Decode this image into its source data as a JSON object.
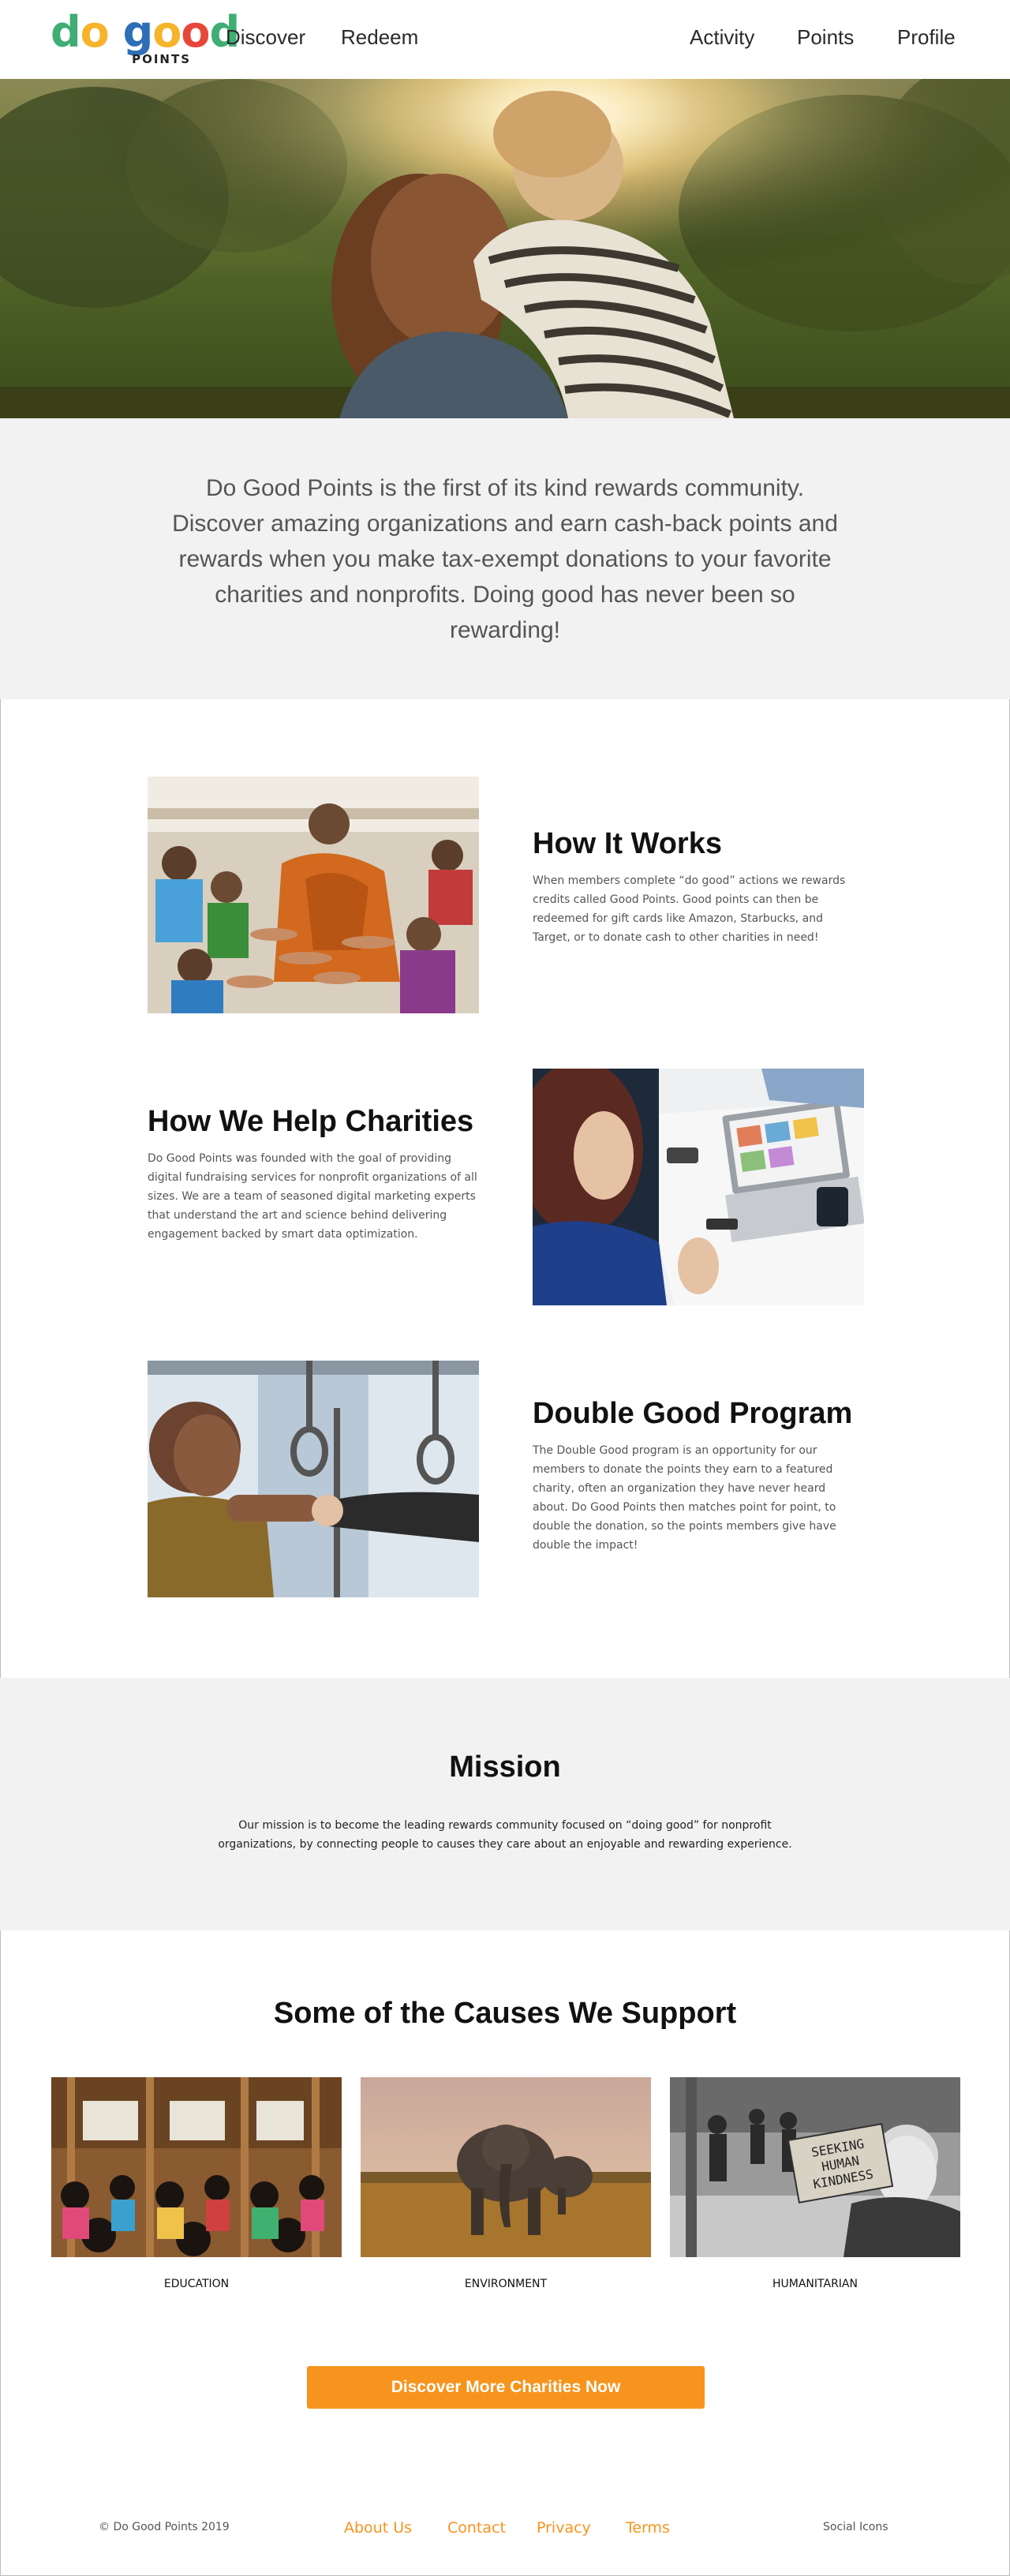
{
  "header": {
    "logo": {
      "word_do": "do",
      "word_good": "good",
      "sub": "POINTS"
    },
    "nav_left": [
      {
        "label": "Discover"
      },
      {
        "label": "Redeem"
      }
    ],
    "nav_right": [
      {
        "label": "Activity"
      },
      {
        "label": "Points"
      },
      {
        "label": "Profile"
      }
    ]
  },
  "intro": {
    "text": "Do Good Points is the first of its kind rewards community. Discover amazing organizations and earn cash-back points and rewards when you make tax-exempt donations to your favorite charities and nonprofits. Doing good has never been so rewarding!"
  },
  "features": [
    {
      "title": "How It Works",
      "body": "When members complete “do good” actions we rewards credits called Good Points. Good points can then be redeemed for gift cards like Amazon, Starbucks, and Target, or to donate cash to other charities in need!"
    },
    {
      "title": "How We Help Charities",
      "body": "Do Good Points was founded with the goal of providing digital fundraising services for nonprofit organizations of all sizes. We are a team of seasoned digital marketing experts that understand the art and science behind delivering engagement backed by smart data optimization."
    },
    {
      "title": "Double Good Program",
      "body": "The Double Good program is an opportunity for our members to donate the points they earn to a featured charity, often an organization they have never heard about. Do Good Points then matches point for point, to double the donation, so the points members give have double the impact!"
    }
  ],
  "mission": {
    "title": "Mission",
    "text": "Our mission is to become the leading rewards community focused on “doing good” for nonprofit organizations, by connecting people to causes they care about an enjoyable and rewarding experience."
  },
  "causes": {
    "title": "Some of the Causes We Support",
    "items": [
      {
        "label": "EDUCATION"
      },
      {
        "label": "ENVIRONMENT"
      },
      {
        "label": "HUMANITARIAN"
      }
    ],
    "sign_text": "SEEKING HUMAN KINDNESS",
    "cta_label": "Discover More Charities Now"
  },
  "footer": {
    "copyright": "© Do Good Points 2019",
    "links": [
      {
        "label": "About Us"
      },
      {
        "label": "Contact"
      },
      {
        "label": "Privacy"
      },
      {
        "label": "Terms"
      }
    ],
    "social": "Social Icons"
  },
  "colors": {
    "accent_orange": "#f7941d",
    "logo_green": "#3fae74",
    "logo_yellow": "#f7b32b",
    "logo_blue": "#2c6fb7",
    "logo_red": "#e8463a",
    "section_gray": "#f2f2f2"
  }
}
